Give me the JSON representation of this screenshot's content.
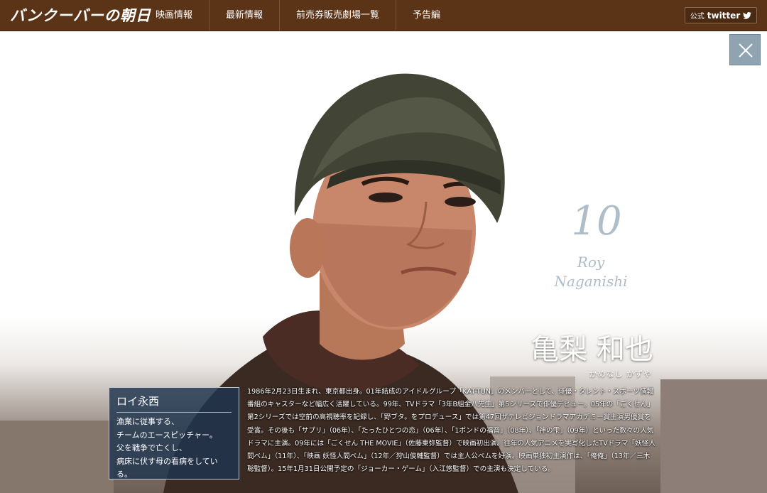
{
  "site": {
    "logo_text": "バンクーバーの朝日"
  },
  "nav": {
    "items": [
      {
        "label": "映画情報"
      },
      {
        "label": "最新情報"
      },
      {
        "label": "前売券販売劇場一覧"
      },
      {
        "label": "予告編"
      }
    ]
  },
  "twitter": {
    "prefix": "公式",
    "word": "twitter",
    "icon": "bird-icon"
  },
  "close": {
    "icon": "close-icon"
  },
  "character": {
    "number": "10",
    "roman_name": "Roy\nNaganishi",
    "actor_name": "亀梨 和也",
    "actor_kana": "かめなし かずや",
    "role_name": "ロイ永西",
    "role_desc_lines": [
      "漁業に従事する、",
      "チームのエースピッチャー。",
      "父を戦争で亡くし、",
      "病床に伏す母の看病をしている。"
    ],
    "bio": "1986年2月23日生まれ、東京都出身。01年結成のアイドルグループ「KAT-TUN」のメンバーとして、俳優・タレント・スポーツ情報番組のキャスターなど幅広く活躍している。99年、TVドラマ「3年B組金八先生」第5シリーズで俳優デビュー。05年の「ごくせん」第2シリーズでは空前の高視聴率を記録し、「野ブタ。をプロデュース」では第47回ザテレビジョンドラマアカデミー賞主演男優賞を受賞。その後も「サプリ」（06年）、「たったひとつの恋」（06年）、「1ポンドの福音」（08年）、「神の雫」（09年）といった数々の人気ドラマに主演。09年には「ごくせん THE MOVIE」（佐藤東弥監督）で映画初出演。往年の人気アニメを実写化したTVドラマ「妖怪人間ベム」（11年）、「映画 妖怪人間ベム」（12年／狩山俊輔監督）では主人公ベムを好演。映画単独初主演作は、「俺俺」（13年／三木聡監督）。15年1月31日公開予定の「ジョーカー・ゲーム」（入江悠監督）での主演も決定している。"
  },
  "colors": {
    "nav_bg": "#5b3418",
    "number_text": "#aebdc7",
    "role_box_bg": "#1e344e",
    "close_bg": "#8fa3b0"
  }
}
